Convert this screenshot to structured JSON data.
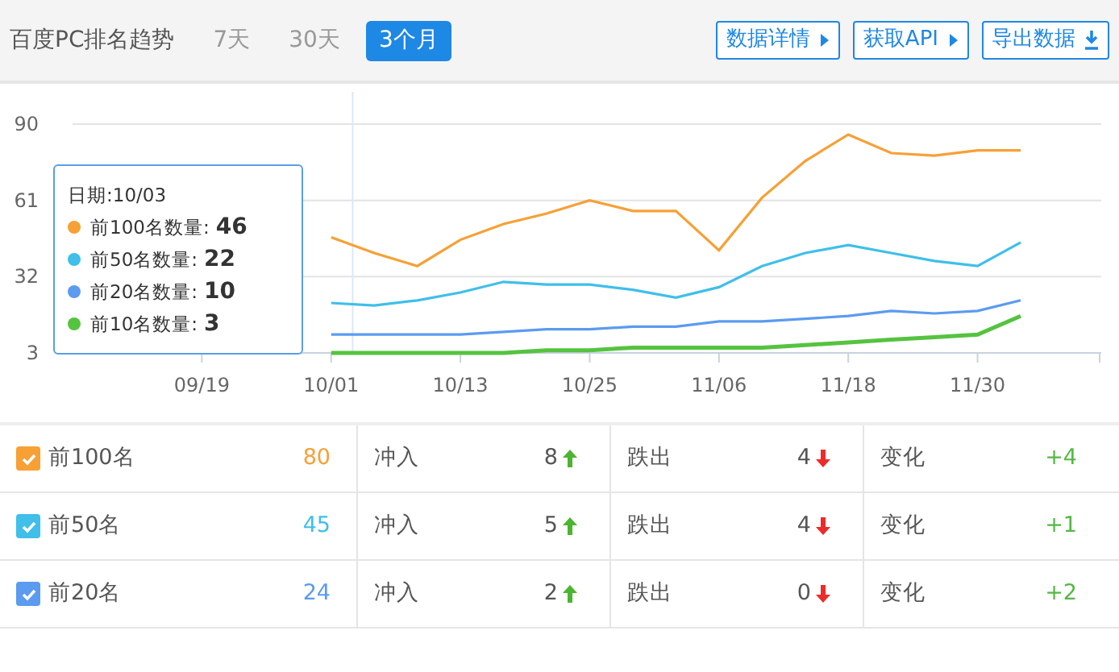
{
  "header": {
    "title": "百度PC排名趋势",
    "ranges": [
      {
        "label": "7天",
        "selected": false
      },
      {
        "label": "30天",
        "selected": false
      },
      {
        "label": "3个月",
        "selected": true
      }
    ],
    "actions": [
      {
        "label": "数据详情",
        "kind": "play"
      },
      {
        "label": "获取API",
        "kind": "play"
      },
      {
        "label": "导出数据",
        "kind": "download"
      }
    ]
  },
  "chart_data": {
    "type": "line",
    "categories": [
      null,
      null,
      null,
      "09/19",
      null,
      null,
      "10/01",
      null,
      null,
      "10/13",
      null,
      null,
      "10/25",
      null,
      null,
      "11/06",
      null,
      null,
      "11/18",
      null,
      null,
      "11/30",
      null
    ],
    "series": [
      {
        "color": "#f7a035",
        "values": [
          null,
          null,
          null,
          null,
          null,
          null,
          47,
          41,
          36,
          46,
          52,
          56,
          61,
          57,
          57,
          42,
          62,
          76,
          86,
          79,
          78,
          80,
          80
        ]
      },
      {
        "color": "#3fbfea",
        "values": [
          null,
          null,
          null,
          null,
          null,
          null,
          22,
          21,
          23,
          26,
          30,
          29,
          29,
          27,
          24,
          28,
          36,
          41,
          44,
          41,
          38,
          36,
          45
        ]
      },
      {
        "color": "#5b9bf0",
        "values": [
          null,
          null,
          null,
          null,
          null,
          null,
          10,
          10,
          10,
          10,
          11,
          12,
          12,
          13,
          13,
          15,
          15,
          16,
          17,
          19,
          18,
          19,
          23
        ]
      },
      {
        "color": "#55c340",
        "values": [
          null,
          null,
          null,
          null,
          null,
          null,
          3,
          3,
          3,
          3,
          3,
          4,
          4,
          5,
          5,
          5,
          5,
          6,
          7,
          8,
          9,
          10,
          17
        ]
      }
    ],
    "ylim": [
      3,
      90
    ],
    "yticks": [
      3,
      32,
      61,
      90
    ]
  },
  "tooltip": {
    "title": "日期:10/03",
    "items": [
      {
        "label": "前100名数量:",
        "value": "46",
        "color": "#f7a035"
      },
      {
        "label": "前50名数量:",
        "value": "22",
        "color": "#3fbfea"
      },
      {
        "label": "前20名数量:",
        "value": "10",
        "color": "#5b9bf0"
      },
      {
        "label": "前10名数量:",
        "value": "3",
        "color": "#55c340"
      }
    ]
  },
  "table": {
    "rows": [
      {
        "name": "前100名",
        "checked": true,
        "color": "#f7a035",
        "count": "80",
        "in_label": "冲入",
        "in": "8",
        "out_label": "跌出",
        "out": "4",
        "change_label": "变化",
        "change": "+4"
      },
      {
        "name": "前50名",
        "checked": true,
        "color": "#3fbfea",
        "count": "45",
        "in_label": "冲入",
        "in": "5",
        "out_label": "跌出",
        "out": "4",
        "change_label": "变化",
        "change": "+1"
      },
      {
        "name": "前20名",
        "checked": true,
        "color": "#5b9bf0",
        "count": "24",
        "in_label": "冲入",
        "in": "2",
        "out_label": "跌出",
        "out": "0",
        "change_label": "变化",
        "change": "+2"
      }
    ]
  }
}
